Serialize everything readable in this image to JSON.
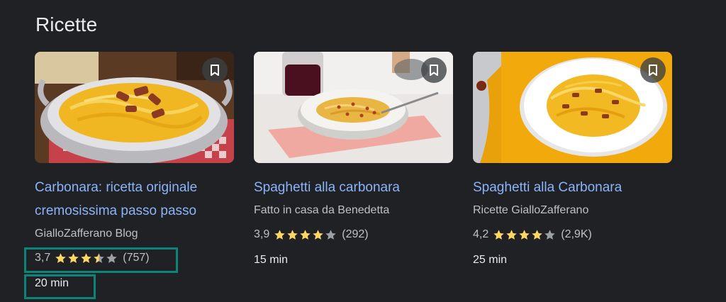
{
  "section": {
    "title": "Ricette"
  },
  "recipes": [
    {
      "title": "Carbonara: ricetta originale cremosissima passo passo",
      "source": "GialloZafferano Blog",
      "rating": "3,7",
      "stars": 3.5,
      "reviews": "(757)",
      "time": "20 min"
    },
    {
      "title": "Spaghetti alla carbonara",
      "source": "Fatto in casa da Benedetta",
      "rating": "3,9",
      "stars": 4,
      "reviews": "(292)",
      "time": "15 min"
    },
    {
      "title": "Spaghetti alla Carbonara",
      "source": "Ricette GialloZafferano",
      "rating": "4,2",
      "stars": 4,
      "reviews": "(2,9K)",
      "time": "25 min"
    }
  ],
  "icons": {
    "bookmark": "bookmark-icon",
    "star": "star-icon"
  },
  "colors": {
    "background": "#202124",
    "link": "#8ab4f8",
    "star_filled": "#fdd663",
    "star_empty": "#9aa0a6",
    "highlight_box": "#0b8579"
  }
}
